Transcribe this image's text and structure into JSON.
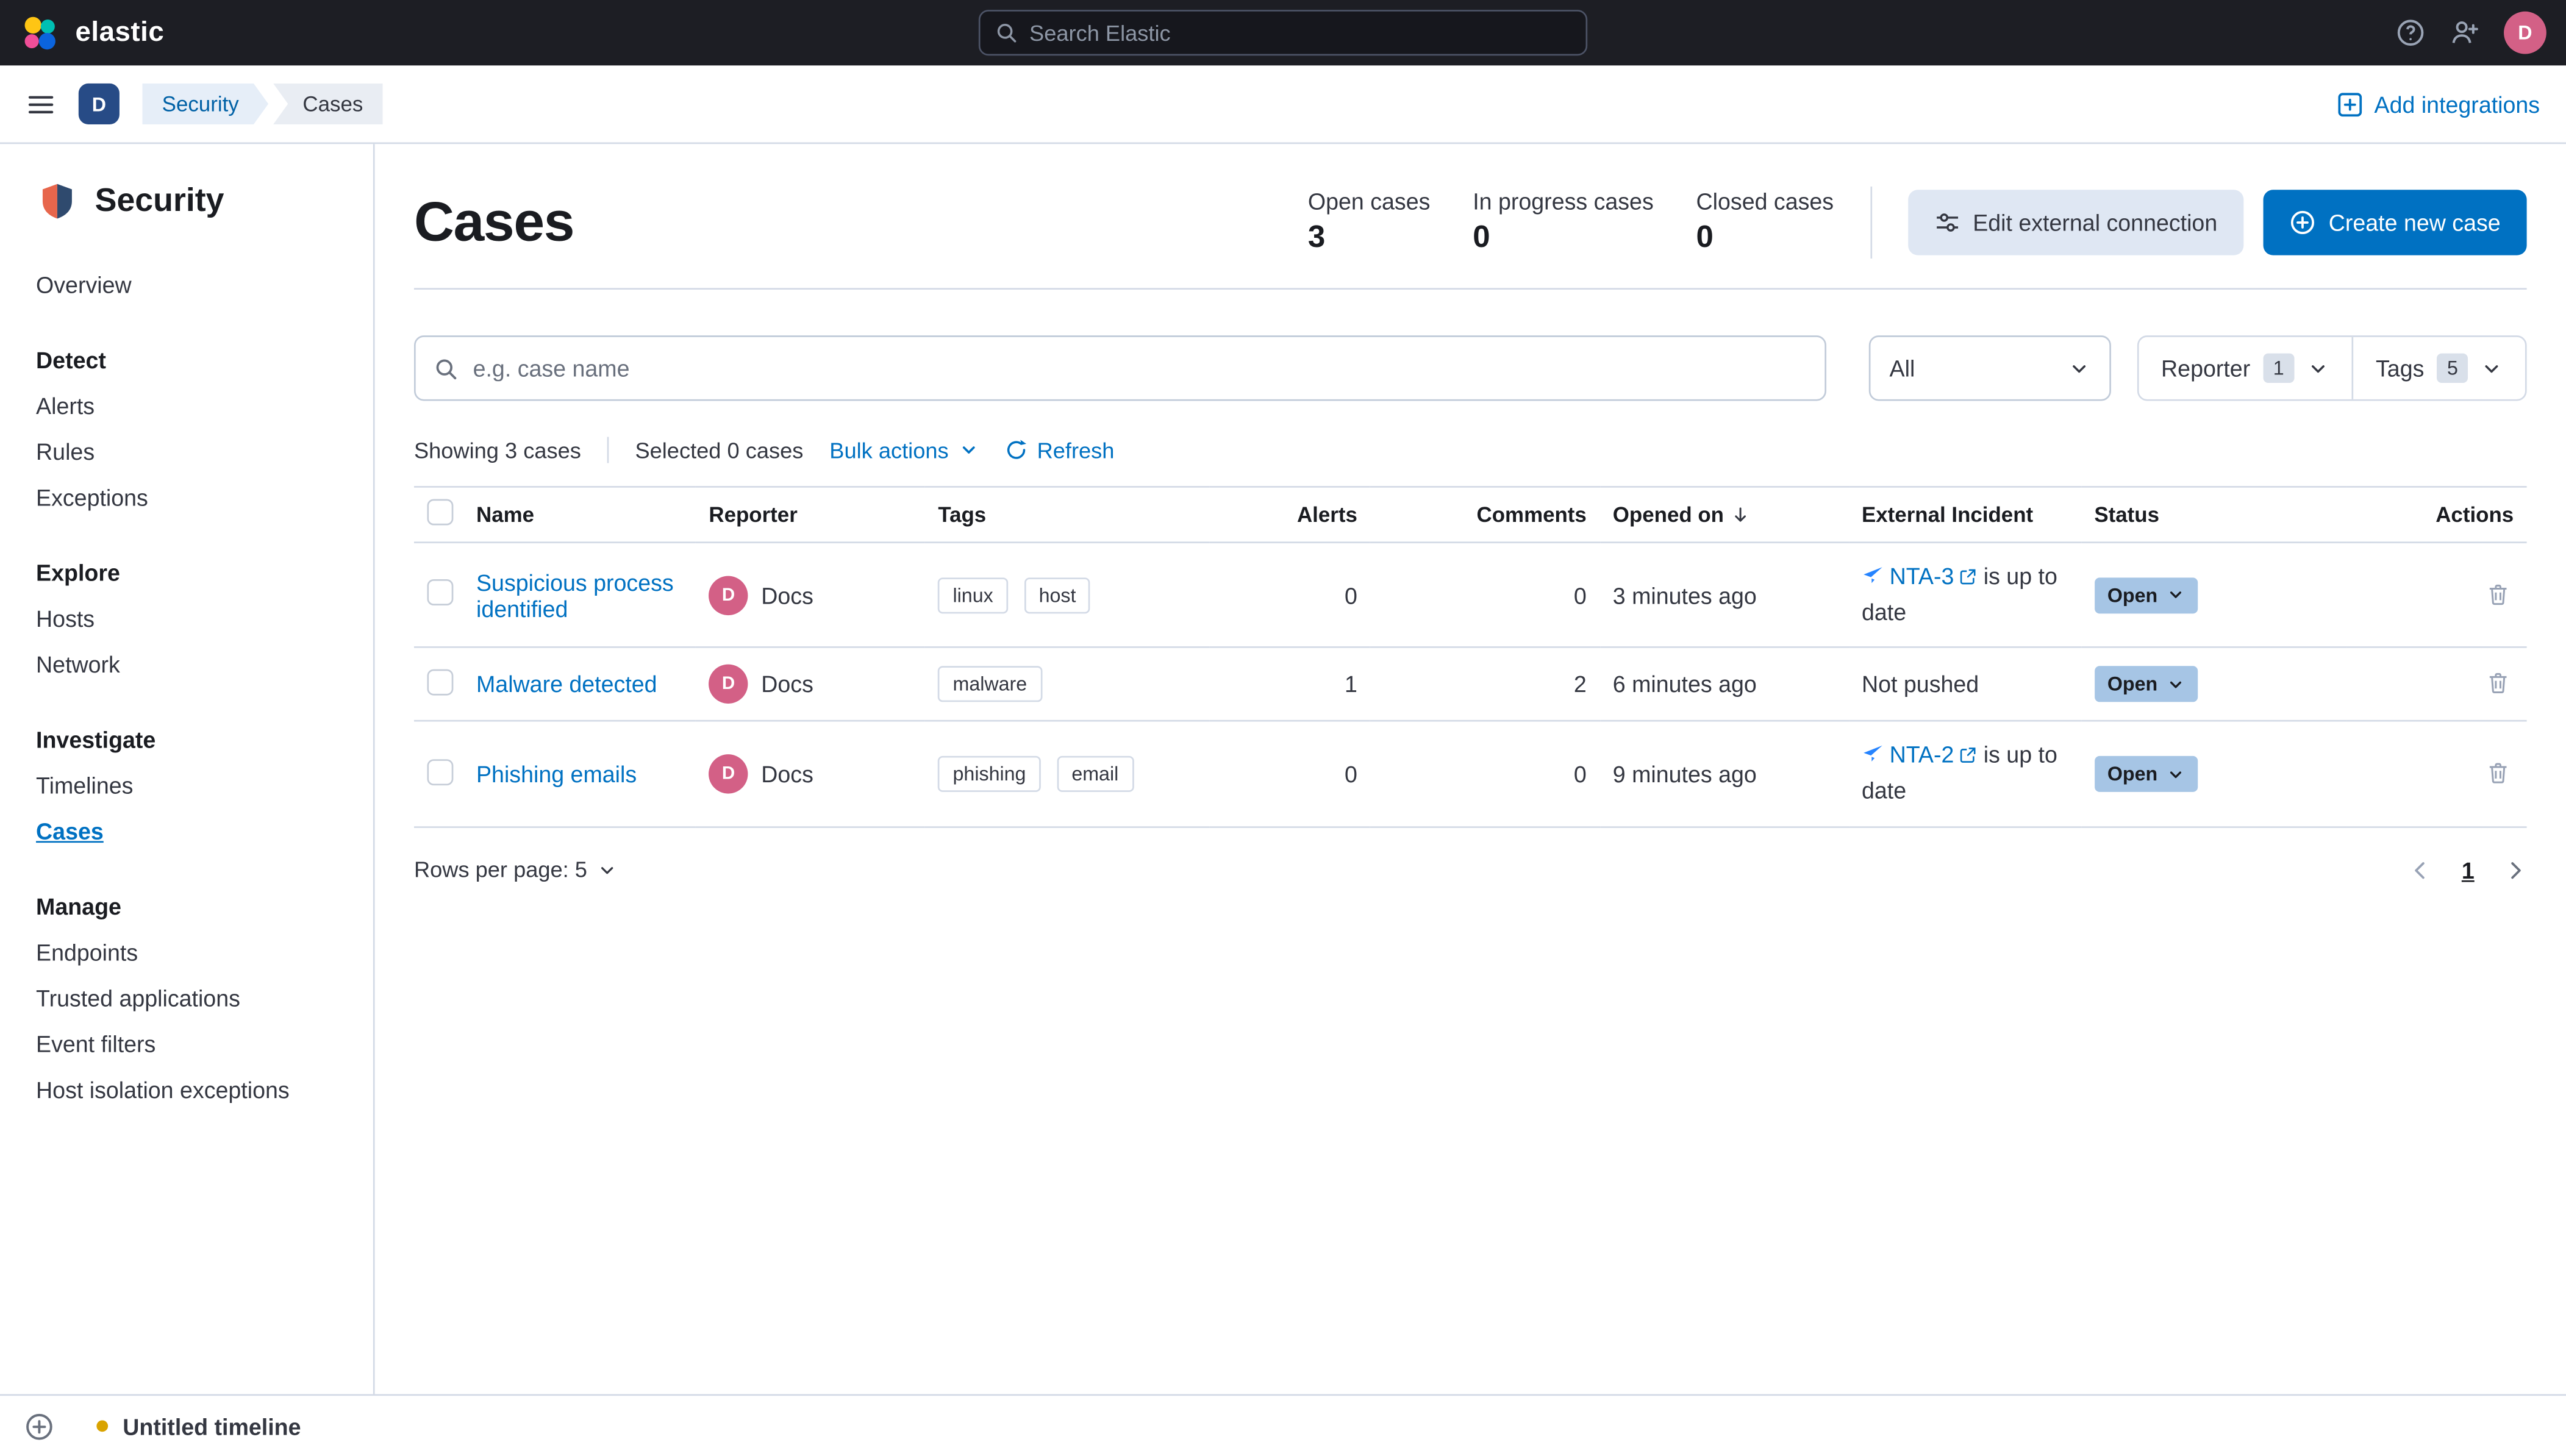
{
  "colors": {
    "accent": "#0071c2",
    "topbar_bg": "#1d1e24",
    "border": "#d3dae6",
    "status_badge_bg": "#a6c5e5",
    "avatar_pink": "#d36086",
    "space_badge_bg": "#274b86",
    "timeline_dot": "#d9a300",
    "external_system_blue": "#2684ff"
  },
  "icons": {
    "elastic-logo": "colored-circle-cluster",
    "search-icon": "magnifier",
    "help-icon": "circled-question",
    "user-add-icon": "person-plus",
    "menu-icon": "hamburger",
    "add-integrations-icon": "boxed-plus",
    "security-app-icon": "shield",
    "sliders-icon": "sliders",
    "plus-circle-icon": "circled-plus",
    "refresh-icon": "circular-arrow",
    "chevron-down-icon": "chevron-down",
    "sort-desc-icon": "arrow-down",
    "external-system-icon": "paper-plane",
    "external-link-icon": "box-with-arrow",
    "trash-icon": "trash-can"
  },
  "topbar": {
    "brand": "elastic",
    "search": {
      "placeholder": "Search Elastic"
    },
    "avatar_initial": "D"
  },
  "navbar": {
    "space_initial": "D",
    "breadcrumbs": [
      {
        "label": "Security"
      },
      {
        "label": "Cases"
      }
    ],
    "add_integrations_label": "Add integrations"
  },
  "sidebar": {
    "app_title": "Security",
    "sections": [
      {
        "header": "",
        "items": [
          {
            "label": "Overview"
          }
        ]
      },
      {
        "header": "Detect",
        "items": [
          {
            "label": "Alerts"
          },
          {
            "label": "Rules"
          },
          {
            "label": "Exceptions"
          }
        ]
      },
      {
        "header": "Explore",
        "items": [
          {
            "label": "Hosts"
          },
          {
            "label": "Network"
          }
        ]
      },
      {
        "header": "Investigate",
        "items": [
          {
            "label": "Timelines"
          },
          {
            "label": "Cases",
            "active": true
          }
        ]
      },
      {
        "header": "Manage",
        "items": [
          {
            "label": "Endpoints"
          },
          {
            "label": "Trusted applications"
          },
          {
            "label": "Event filters"
          },
          {
            "label": "Host isolation exceptions"
          }
        ]
      }
    ]
  },
  "timeline_bar": {
    "label": "Untitled timeline"
  },
  "page": {
    "title": "Cases",
    "stats": [
      {
        "label": "Open cases",
        "value": "3"
      },
      {
        "label": "In progress cases",
        "value": "0"
      },
      {
        "label": "Closed cases",
        "value": "0"
      }
    ],
    "edit_external_label": "Edit external connection",
    "create_case_label": "Create new case",
    "search_placeholder": "e.g. case name",
    "solution_filter_value": "All",
    "reporter_filter": {
      "label": "Reporter",
      "count": "1"
    },
    "tags_filter": {
      "label": "Tags",
      "count": "5"
    },
    "toolbar": {
      "showing": "Showing 3 cases",
      "selected": "Selected 0 cases",
      "bulk_actions": "Bulk actions",
      "refresh": "Refresh"
    },
    "table": {
      "headers": {
        "name": "Name",
        "reporter": "Reporter",
        "tags": "Tags",
        "alerts": "Alerts",
        "comments": "Comments",
        "opened": "Opened on",
        "external": "External Incident",
        "status": "Status",
        "actions": "Actions"
      },
      "rows": [
        {
          "name": "Suspicious process identified",
          "avatar": "D",
          "reporter": "Docs",
          "tags": [
            "linux",
            "host"
          ],
          "alerts": "0",
          "comments": "0",
          "opened": "3 minutes ago",
          "external_link": "NTA-3",
          "external_text": "is up to date",
          "status": "Open"
        },
        {
          "name": "Malware detected",
          "avatar": "D",
          "reporter": "Docs",
          "tags": [
            "malware"
          ],
          "alerts": "1",
          "comments": "2",
          "opened": "6 minutes ago",
          "external_text": "Not pushed",
          "status": "Open"
        },
        {
          "name": "Phishing emails",
          "avatar": "D",
          "reporter": "Docs",
          "tags": [
            "phishing",
            "email"
          ],
          "alerts": "0",
          "comments": "0",
          "opened": "9 minutes ago",
          "external_link": "NTA-2",
          "external_text": "is up to date",
          "status": "Open"
        }
      ]
    },
    "footer": {
      "rows_per_page": "Rows per page: 5",
      "page": "1"
    }
  }
}
